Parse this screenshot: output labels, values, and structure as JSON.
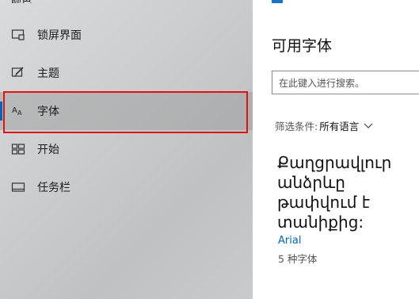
{
  "sidebar": {
    "top_partial_label": "颜色",
    "items": [
      {
        "label": "锁屏界面",
        "icon": "lock-screen-icon"
      },
      {
        "label": "主题",
        "icon": "theme-brush-icon"
      },
      {
        "label": "字体",
        "icon": "font-icon"
      },
      {
        "label": "开始",
        "icon": "start-menu-icon"
      },
      {
        "label": "任务栏",
        "icon": "taskbar-icon"
      }
    ],
    "selected": "字体"
  },
  "content": {
    "section_title": "可用字体",
    "search_placeholder": "在此键入进行搜索。",
    "filter_label": "筛选条件:",
    "filter_value": "所有语言",
    "font_card": {
      "preview_text": "Քաղցրավլուր անձրևը թափվում է տանիքից:",
      "font_name": "Arial",
      "face_count": "5 种字体"
    }
  },
  "colors": {
    "accent": "#0067c0",
    "highlight_border": "#e0140f",
    "link": "#0066cc"
  }
}
